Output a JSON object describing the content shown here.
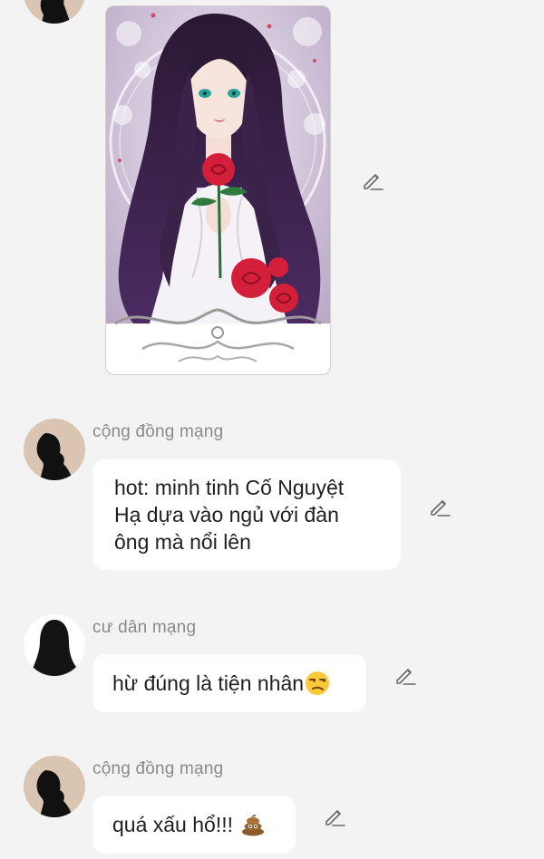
{
  "icons": {
    "edit": "pencil-edit-icon",
    "emoji_unamused": "unamused-face-emoji",
    "emoji_poop": "pile-of-poo-emoji"
  },
  "colors": {
    "background": "#f3f3f3",
    "bubble": "#ffffff",
    "sender_name": "#8a8a8a",
    "message_text": "#1f1f1f",
    "avatar_beige": "#d9c5b2"
  },
  "messages": [
    {
      "sender": "",
      "type": "image"
    },
    {
      "sender": "cộng đồng mạng",
      "lines": [
        "hot: minh tinh Cố Nguyệt",
        "Hạ dựa vào ngủ với đàn",
        "ông mà nổi lên"
      ]
    },
    {
      "sender": "cư dân mạng",
      "text": "hừ đúng là tiện nhân"
    },
    {
      "sender": "cộng đồng mạng",
      "text": "quá xấu hổ!!!"
    }
  ]
}
